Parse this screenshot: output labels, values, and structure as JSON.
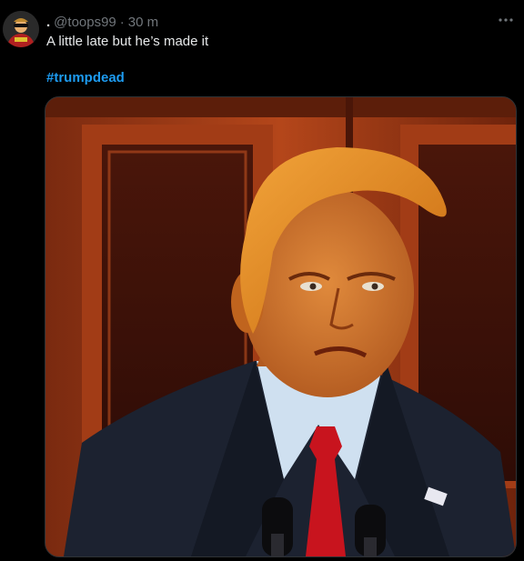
{
  "tweet": {
    "display_name": ".",
    "handle": "@toops99",
    "separator": "·",
    "timestamp": "30 m",
    "text": "A little late but he’s made it",
    "hashtag": "#trumpdead",
    "more_icon": "more-horizontal-icon",
    "media": {
      "type": "photo",
      "subject": "man in dark suit, white shirt, red tie with orange hair at podium with microphones in front of wooden doors",
      "colors": {
        "wood": "#9a3514",
        "suit": "#1c2230",
        "shirt": "#cfe0f0",
        "tie": "#c8141e",
        "hair": "#e88a18",
        "skin": "#d4742c"
      }
    }
  },
  "colors": {
    "background": "#000000",
    "text_primary": "#e7e9ea",
    "text_secondary": "#71767b",
    "accent": "#1d9bf0"
  }
}
